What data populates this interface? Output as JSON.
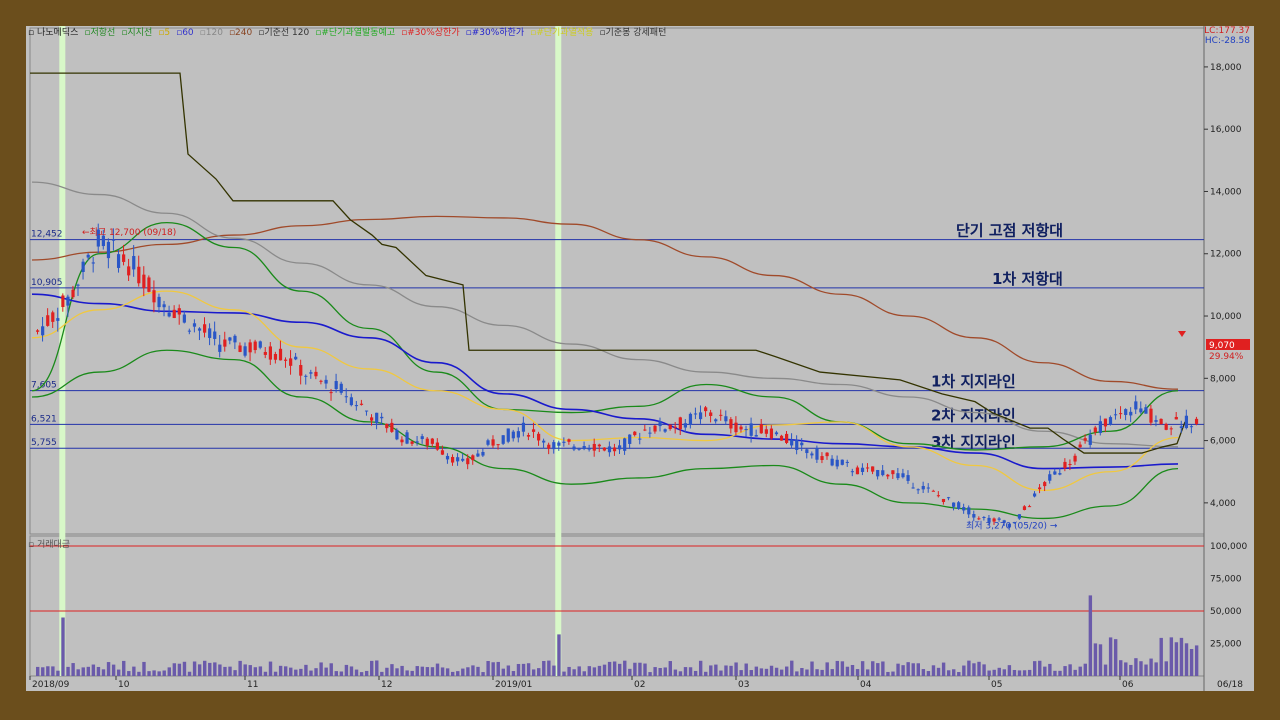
{
  "legend": [
    {
      "text": "나노메딕스",
      "color": "#222222"
    },
    {
      "text": "저항선",
      "color": "#228822"
    },
    {
      "text": "지지선",
      "color": "#228822"
    },
    {
      "text": "5",
      "color": "#ccaa00"
    },
    {
      "text": "60",
      "color": "#3333cc"
    },
    {
      "text": "120",
      "color": "#888888"
    },
    {
      "text": "240",
      "color": "#884422"
    },
    {
      "text": "기준선 120",
      "color": "#333333"
    },
    {
      "text": "#단기과열발동예고",
      "color": "#22aa22"
    },
    {
      "text": "#30%상한가",
      "color": "#dd2222"
    },
    {
      "text": "#30%하한가",
      "color": "#2222cc"
    },
    {
      "text": "#단기과열적용",
      "color": "#cccc22"
    },
    {
      "text": "기준봉 강세패턴",
      "color": "#333333"
    }
  ],
  "top_right": {
    "lc": "LC:177.37",
    "hc": "HC:-28.58"
  },
  "volume_title": "거래대금",
  "colors": {
    "up": "#e02020",
    "down": "#2a56c6",
    "ma5": "#f0c840",
    "ma60": "#1a1acc",
    "ma120": "#8a8a8a",
    "ma240": "#a04a2a",
    "base": "#333300",
    "band": "#1a8a1a",
    "level": "#2233aa",
    "highlight": "#d8f8c8",
    "vol": "#6a5aaa",
    "vol_ref": "#dd2222"
  },
  "chart_data": {
    "type": "candlestick",
    "x_ticks": [
      "2018/09",
      "10",
      "11",
      "12",
      "2019/01",
      "02",
      "03",
      "04",
      "05",
      "06",
      "06/18"
    ],
    "ylim": [
      3000,
      18800
    ],
    "y_ticks": [
      "4,000",
      "6,000",
      "8,000",
      "10,000",
      "12,000",
      "14,000",
      "16,000",
      "18,000"
    ],
    "price_tag": {
      "value": 9070,
      "label": "9,070",
      "pct": "29.94%"
    },
    "levels": [
      {
        "value": 12452,
        "label": "12,452"
      },
      {
        "value": 10905,
        "label": "10,905"
      },
      {
        "value": 7605,
        "label": "7,605"
      },
      {
        "value": 6521,
        "label": "6,521"
      },
      {
        "value": 5755,
        "label": "5,755"
      }
    ],
    "annotations": [
      {
        "text": "단기 고점 저항대",
        "level": 12452
      },
      {
        "text": "1차 저항대",
        "level": 10905
      },
      {
        "text": "1차 지지라인",
        "level": 7605
      },
      {
        "text": "2차 지지라인",
        "level": 6521
      },
      {
        "text": "3차 지지라인",
        "level": 5755
      }
    ],
    "high_label": {
      "text": "최고 12,700 (09/18)",
      "value": 12700
    },
    "low_label": {
      "text": "최저 3,270 (05/20)",
      "value": 3270
    },
    "highlight_dates": [
      "09/18",
      "02/07"
    ],
    "ma240": [
      11800,
      12050,
      12300,
      12600,
      12900,
      13100,
      13200,
      13150,
      12950,
      12450,
      11900,
      11300,
      10700,
      10000,
      9300,
      8500,
      7900,
      7650
    ],
    "ma120": [
      14300,
      13900,
      13300,
      12500,
      11700,
      11000,
      10300,
      9700,
      9100,
      8600,
      8200,
      8000,
      7800,
      7400,
      6900,
      6300,
      5900,
      5800
    ],
    "ma60": [
      10700,
      10400,
      10150,
      10100,
      9800,
      9300,
      8500,
      7500,
      7000,
      6700,
      6200,
      6050,
      5900,
      5800,
      5600,
      5100,
      5150,
      5250
    ],
    "ma5": [
      9300,
      10200,
      10800,
      10200,
      9000,
      8300,
      7600,
      7000,
      6000,
      6100,
      6000,
      6500,
      6600,
      5800,
      5200,
      4400,
      5000,
      6100
    ],
    "band_up": [
      7600,
      12000,
      13000,
      12200,
      10800,
      9600,
      8200,
      7000,
      6900,
      7100,
      7800,
      7400,
      6600,
      5900,
      5700,
      5800,
      6300,
      7600
    ],
    "band_dn": [
      7400,
      8200,
      8900,
      8600,
      7400,
      6600,
      5800,
      5100,
      4600,
      4800,
      5100,
      5200,
      4600,
      4000,
      3800,
      3500,
      3900,
      5100
    ],
    "base_line": [
      [
        0,
        17800
      ],
      [
        150,
        17800
      ],
      [
        158,
        15200
      ],
      [
        172,
        14800
      ],
      [
        186,
        14400
      ],
      [
        203,
        13700
      ],
      [
        303,
        13700
      ],
      [
        320,
        13100
      ],
      [
        342,
        12600
      ],
      [
        352,
        12300
      ],
      [
        366,
        12200
      ],
      [
        396,
        11300
      ],
      [
        433,
        11000
      ],
      [
        439,
        8900
      ],
      [
        456,
        8900
      ],
      [
        460,
        8900
      ],
      [
        610,
        8900
      ],
      [
        726,
        8900
      ],
      [
        745,
        8700
      ],
      [
        790,
        8200
      ],
      [
        870,
        7950
      ],
      [
        912,
        7500
      ],
      [
        945,
        7250
      ],
      [
        962,
        6900
      ],
      [
        1000,
        6400
      ],
      [
        1018,
        6400
      ],
      [
        1033,
        6050
      ],
      [
        1054,
        5600
      ],
      [
        1112,
        5600
      ],
      [
        1133,
        5800
      ],
      [
        1147,
        5900
      ],
      [
        1155,
        6600
      ]
    ],
    "price_path": [
      9500,
      10500,
      12400,
      11700,
      10600,
      9800,
      9100,
      9000,
      8800,
      8000,
      7600,
      6800,
      6100,
      5900,
      5200,
      6000,
      6400,
      5800,
      5900,
      5700,
      6400,
      6500,
      6900,
      6400,
      6300,
      5800,
      5400,
      5000,
      5000,
      4500,
      4000,
      3500,
      3300,
      4600,
      5500,
      6600,
      7100,
      6500,
      6700
    ],
    "volume": {
      "ylim": [
        0,
        100000
      ],
      "y_ticks": [
        "25,000",
        "50,000",
        "75,000",
        "100,000"
      ],
      "ref": [
        50000,
        100000
      ],
      "spikes": [
        {
          "date": "09/18",
          "value": 45000
        },
        {
          "date": "02/07",
          "value": 32000
        },
        {
          "date": "05/21",
          "value": 62000
        }
      ]
    }
  }
}
